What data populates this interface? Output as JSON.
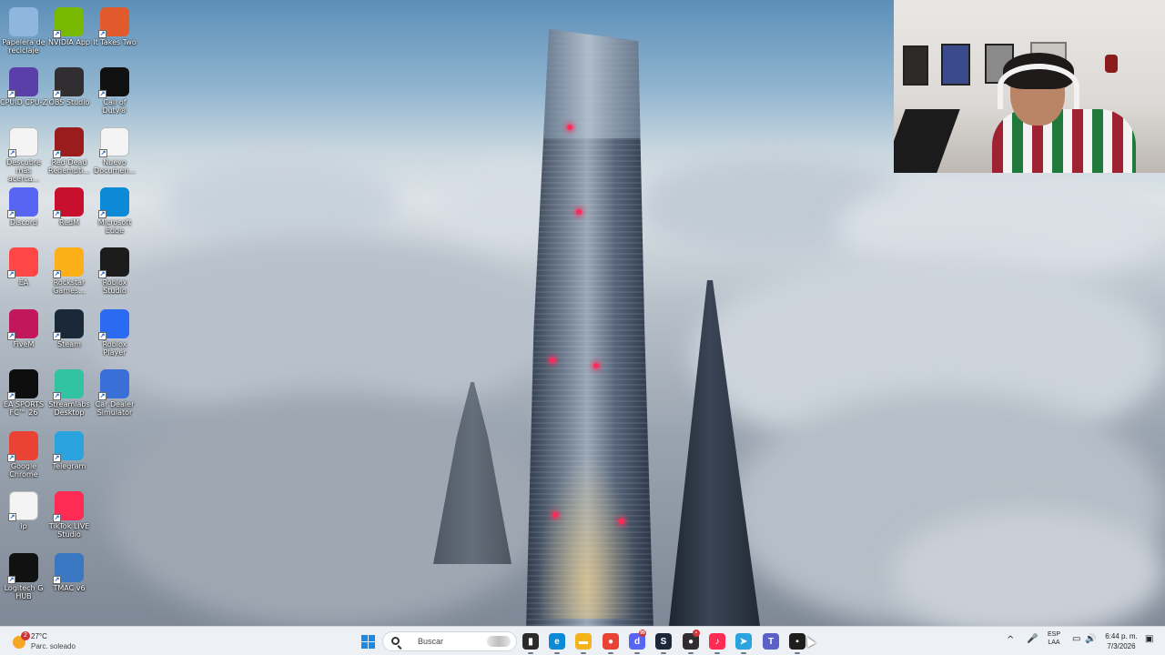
{
  "desktop": {
    "icons": [
      {
        "label": "Papelera de reciclaje",
        "icon": "recycle-bin-icon",
        "color": "#8fb7dd"
      },
      {
        "label": "NVIDIA App",
        "icon": "nvidia-icon",
        "color": "#76b900"
      },
      {
        "label": "It Takes Two",
        "icon": "it-takes-two-icon",
        "color": "#e05a2b"
      },
      {
        "label": "CPUID CPU-Z",
        "icon": "cpuz-icon",
        "color": "#5b3fa8"
      },
      {
        "label": "OBS Studio",
        "icon": "obs-icon",
        "color": "#302e31"
      },
      {
        "label": "Call of Duty®",
        "icon": "call-of-duty-icon",
        "color": "#111111"
      },
      {
        "label": "Descubre más acerca...",
        "icon": "document-icon",
        "color": "#f4f4f4"
      },
      {
        "label": "Red Dead Redempti...",
        "icon": "red-dead-icon",
        "color": "#9b1c1c"
      },
      {
        "label": "Nuevo Documen...",
        "icon": "text-file-icon",
        "color": "#f4f4f4"
      },
      {
        "label": "Discord",
        "icon": "discord-icon",
        "color": "#5865f2"
      },
      {
        "label": "RedM",
        "icon": "redm-icon",
        "color": "#c8102e"
      },
      {
        "label": "Microsoft Edge",
        "icon": "edge-icon",
        "color": "#0c8ad6"
      },
      {
        "label": "EA",
        "icon": "ea-icon",
        "color": "#ff4747"
      },
      {
        "label": "Rockstar Games...",
        "icon": "rockstar-icon",
        "color": "#fcaf17"
      },
      {
        "label": "Roblox Studio",
        "icon": "roblox-studio-icon",
        "color": "#1b1b1b"
      },
      {
        "label": "FiveM",
        "icon": "fivem-icon",
        "color": "#c2185b"
      },
      {
        "label": "Steam",
        "icon": "steam-icon",
        "color": "#1b2838"
      },
      {
        "label": "Roblox Player",
        "icon": "roblox-player-icon",
        "color": "#2a6bf2"
      },
      {
        "label": "EA SPORTS FC™ 26",
        "icon": "ea-fc-icon",
        "color": "#0e0e0e"
      },
      {
        "label": "Streamlabs Desktop",
        "icon": "streamlabs-icon",
        "color": "#31c3a2"
      },
      {
        "label": "Car Dealer Simulator",
        "icon": "car-dealer-icon",
        "color": "#3a6fd8"
      },
      {
        "label": "Google Chrome",
        "icon": "chrome-icon",
        "color": "#ea4335"
      },
      {
        "label": "Telegram",
        "icon": "telegram-icon",
        "color": "#2aa3df"
      },
      {
        "label": "ip",
        "icon": "text-file-icon",
        "color": "#f4f4f4"
      },
      {
        "label": "TikTok LIVE Studio",
        "icon": "tiktok-icon",
        "color": "#fe2c55"
      },
      {
        "label": "Logitech G HUB",
        "icon": "logitech-icon",
        "color": "#111111"
      },
      {
        "label": "TMAC v6",
        "icon": "tmac-icon",
        "color": "#3b78c4"
      }
    ]
  },
  "taskbar": {
    "weather": {
      "temp": "27°C",
      "condition": "Parc. soleado",
      "badge": "2"
    },
    "search": {
      "placeholder": "Buscar"
    },
    "pinned": [
      {
        "name": "start-button",
        "icon": "windows-start-icon"
      },
      {
        "name": "taskview-button",
        "icon": "task-view-icon",
        "glyph": "▮",
        "color": "#2b2b2b"
      },
      {
        "name": "edge-button",
        "icon": "edge-icon",
        "glyph": "e",
        "color": "#0c8ad6"
      },
      {
        "name": "file-explorer-button",
        "icon": "folder-icon",
        "glyph": "▬",
        "color": "#f3b41b"
      },
      {
        "name": "chrome-button",
        "icon": "chrome-icon",
        "glyph": "●",
        "color": "#ea4335"
      },
      {
        "name": "discord-button",
        "icon": "discord-icon",
        "glyph": "d",
        "color": "#5865f2",
        "badge": "99"
      },
      {
        "name": "steam-button",
        "icon": "steam-icon",
        "glyph": "S",
        "color": "#1b2838"
      },
      {
        "name": "obs-button",
        "icon": "obs-icon",
        "glyph": "●",
        "color": "#302e31",
        "badge": "•"
      },
      {
        "name": "tiktok-button",
        "icon": "tiktok-icon",
        "glyph": "♪",
        "color": "#fe2c55"
      },
      {
        "name": "telegram-button",
        "icon": "telegram-icon",
        "glyph": "➤",
        "color": "#2aa3df"
      },
      {
        "name": "teams-button",
        "icon": "teams-icon",
        "glyph": "T",
        "color": "#5b5fc7"
      },
      {
        "name": "terminal-button",
        "icon": "terminal-icon",
        "glyph": "▪",
        "color": "#1e1e1e"
      }
    ],
    "tray": {
      "chevron": "^",
      "mic": "🎤",
      "lang_top": "ESP",
      "lang_bottom": "LAA",
      "network": "▭",
      "volume": "🔊",
      "battery": "▮",
      "time": "6:44 p. m.",
      "date": "7/3/2026",
      "notification": "▣"
    }
  }
}
